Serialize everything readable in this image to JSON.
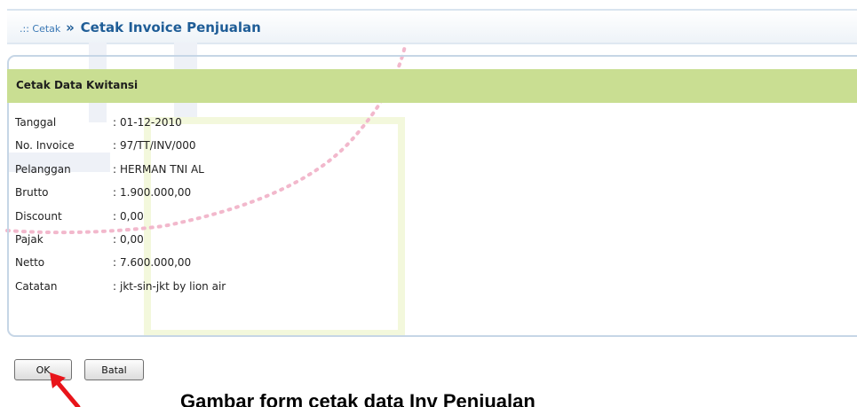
{
  "breadcrumb": {
    "prefix": ".:: Cetak",
    "separator": "»",
    "title": "Cetak Invoice Penjualan"
  },
  "panel": {
    "title": "Cetak Data Kwitansi",
    "fields": [
      {
        "label": "Tanggal",
        "value": "01-12-2010"
      },
      {
        "label": "No. Invoice",
        "value": "97/TT/INV/000"
      },
      {
        "label": "Pelanggan",
        "value": "HERMAN TNI AL"
      },
      {
        "label": "Brutto",
        "value": "1.900.000,00"
      },
      {
        "label": "Discount",
        "value": "0,00"
      },
      {
        "label": "Pajak",
        "value": "0,00"
      },
      {
        "label": "Netto",
        "value": "7.600.000,00"
      },
      {
        "label": "Catatan",
        "value": "jkt-sin-jkt by lion air"
      }
    ]
  },
  "buttons": {
    "ok": "OK",
    "batal": "Batal"
  },
  "caption": "Gambar form cetak data Inv Penjualan",
  "colors": {
    "header_text": "#1f5d97",
    "panel_header_bg": "#c9de92",
    "panel_border": "#c6d6e6",
    "arrow": "#e8141a"
  }
}
